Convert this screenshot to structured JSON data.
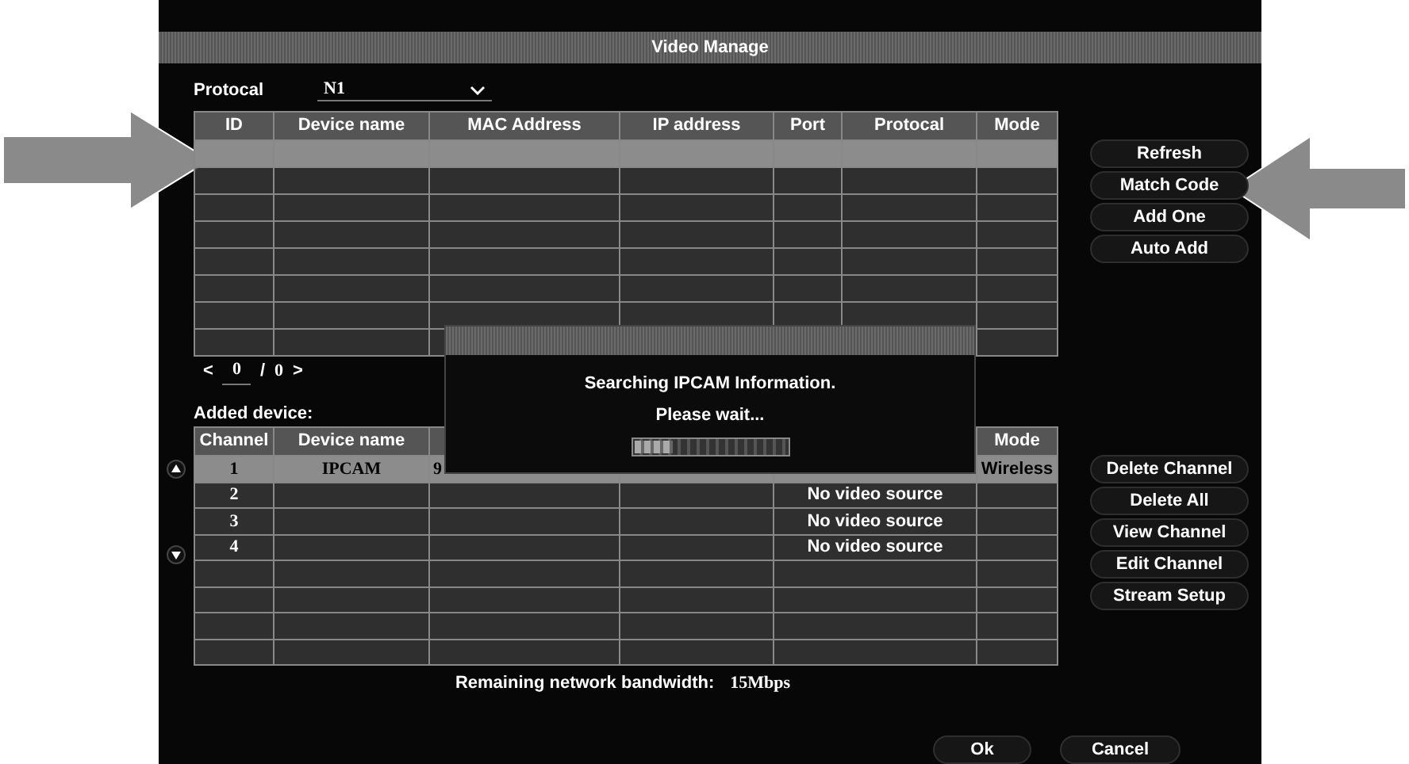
{
  "window": {
    "title": "Video Manage"
  },
  "protocol": {
    "label": "Protocal",
    "value": "N1"
  },
  "search_table": {
    "columns": [
      "ID",
      "Device name",
      "MAC Address",
      "IP address",
      "Port",
      "Protocal",
      "Mode"
    ],
    "rows": [
      {
        "selected": true
      },
      {
        "selected": false
      },
      {
        "selected": false
      },
      {
        "selected": false
      },
      {
        "selected": false
      },
      {
        "selected": false
      },
      {
        "selected": false
      },
      {
        "selected": false
      }
    ]
  },
  "pager": {
    "prev": "<",
    "page": "0",
    "separator": "/",
    "total": "0",
    "next": ">"
  },
  "search_buttons": [
    "Refresh",
    "Match Code",
    "Add One",
    "Auto Add"
  ],
  "added": {
    "label": "Added device:",
    "columns": [
      "Channel",
      "Device name",
      "Mode"
    ],
    "rows": [
      {
        "selected": true,
        "channel": "1",
        "device_name": "IPCAM",
        "column_3": "9",
        "mode": "Wireless"
      },
      {
        "selected": false,
        "channel": "2",
        "column_5": "No video source"
      },
      {
        "selected": false,
        "channel": "3",
        "column_5": "No video source"
      },
      {
        "selected": false,
        "channel": "4",
        "column_5": "No video source"
      },
      {
        "selected": false
      },
      {
        "selected": false
      },
      {
        "selected": false
      },
      {
        "selected": false
      }
    ]
  },
  "channel_buttons": [
    "Delete Channel",
    "Delete All",
    "View Channel",
    "Edit Channel",
    "Stream Setup"
  ],
  "bandwidth": {
    "label": "Remaining network bandwidth:",
    "value": "15Mbps"
  },
  "footer_buttons": [
    "Ok",
    "Cancel"
  ],
  "dialog": {
    "lines": [
      "Searching IPCAM Information.",
      "Please wait..."
    ],
    "progress": {
      "level": 0.25
    }
  }
}
